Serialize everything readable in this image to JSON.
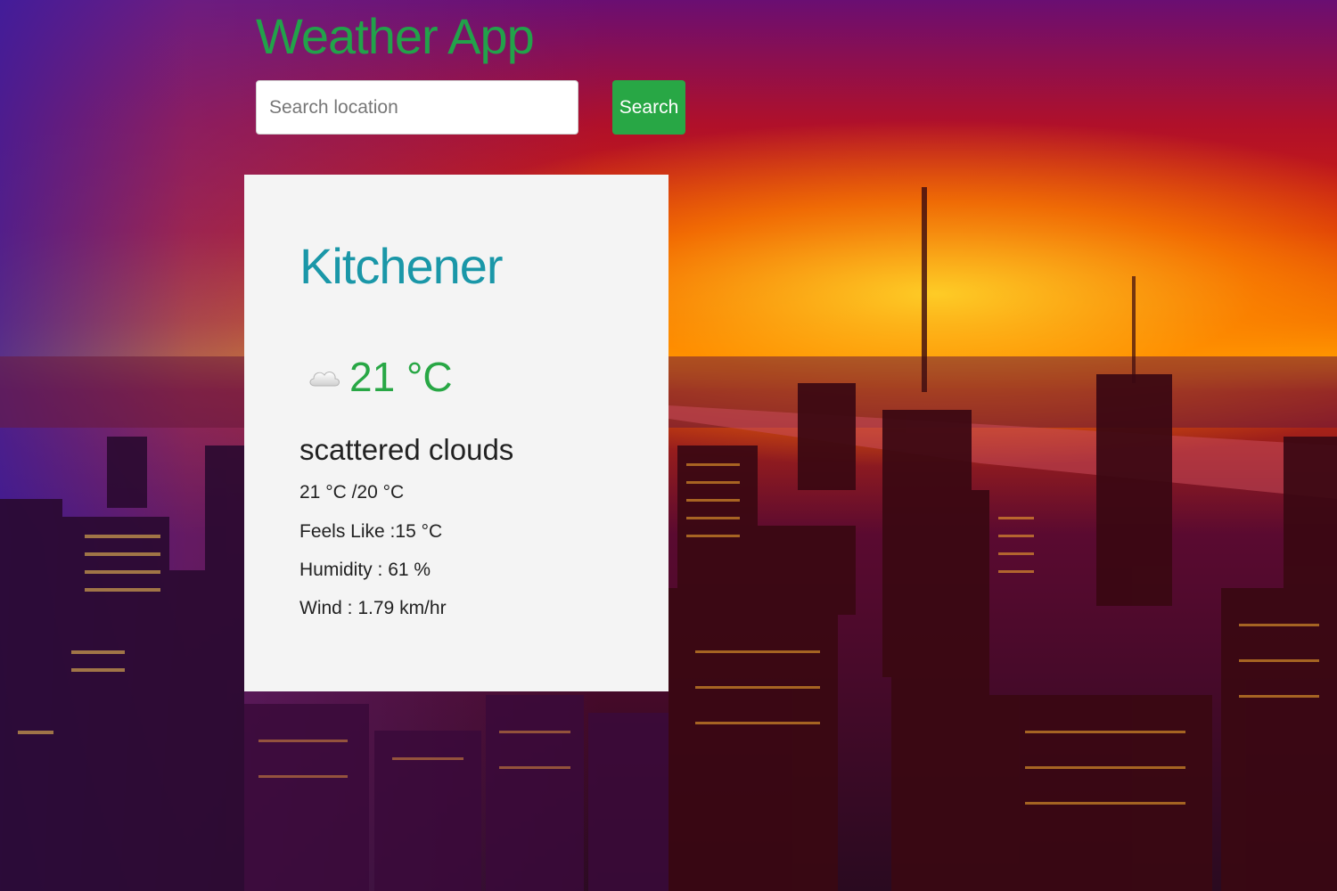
{
  "app": {
    "title": "Weather App"
  },
  "search": {
    "placeholder": "Search location",
    "value": "",
    "button_label": "Search"
  },
  "weather": {
    "city": "Kitchener",
    "icon": "cloud-icon",
    "temperature": "21 °C",
    "description": "scattered clouds",
    "high_low": "21 °C /20 °C",
    "feels_like_label": "Feels Like :",
    "feels_like_value": "15 °C",
    "humidity_label": "Humidity :",
    "humidity_value": "61 %",
    "wind_label": "Wind :",
    "wind_value": "1.79 km/hr"
  },
  "colors": {
    "accent_green": "#28a745",
    "city_teal": "#1a97a8",
    "card_bg": "#f4f4f4"
  }
}
